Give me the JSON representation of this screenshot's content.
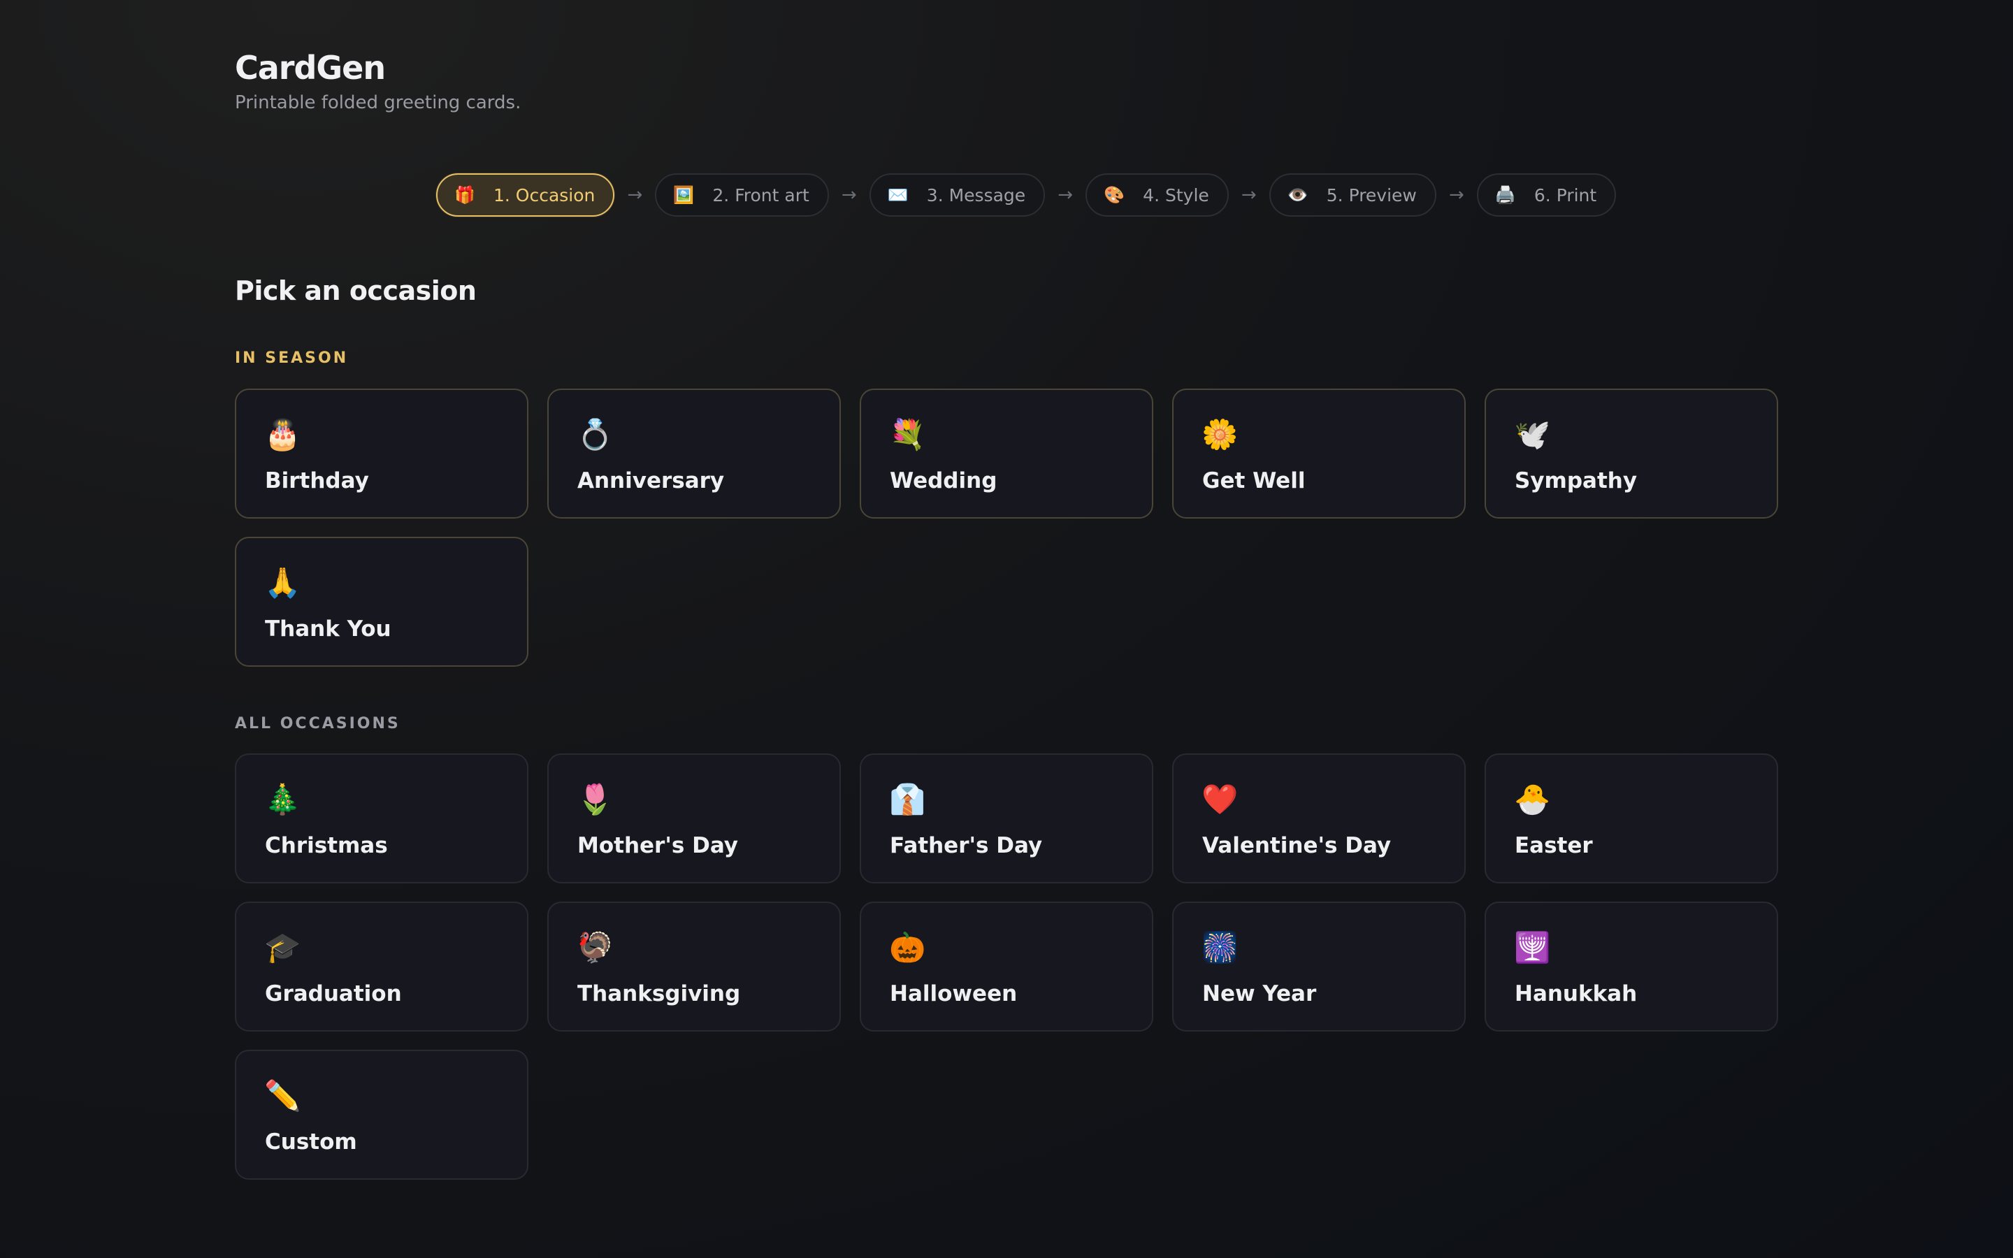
{
  "app": {
    "title": "CardGen",
    "subtitle": "Printable folded greeting cards."
  },
  "stepper": {
    "steps": [
      {
        "icon": "🎁",
        "label": "1. Occasion",
        "active": true
      },
      {
        "icon": "🖼️",
        "label": "2. Front art",
        "active": false
      },
      {
        "icon": "✉️",
        "label": "3. Message",
        "active": false
      },
      {
        "icon": "🎨",
        "label": "4. Style",
        "active": false
      },
      {
        "icon": "👁️",
        "label": "5. Preview",
        "active": false
      },
      {
        "icon": "🖨️",
        "label": "6. Print",
        "active": false
      }
    ],
    "separator": "→"
  },
  "main": {
    "heading": "Pick an occasion",
    "in_season": {
      "label": "IN SEASON",
      "cards": [
        {
          "icon": "🎂",
          "label": "Birthday"
        },
        {
          "icon": "💍",
          "label": "Anniversary"
        },
        {
          "icon": "💐",
          "label": "Wedding"
        },
        {
          "icon": "🌼",
          "label": "Get Well"
        },
        {
          "icon": "🕊️",
          "label": "Sympathy"
        },
        {
          "icon": "🙏",
          "label": "Thank You"
        }
      ]
    },
    "all": {
      "label": "ALL OCCASIONS",
      "cards": [
        {
          "icon": "🎄",
          "label": "Christmas"
        },
        {
          "icon": "🌷",
          "label": "Mother's Day"
        },
        {
          "icon": "👔",
          "label": "Father's Day"
        },
        {
          "icon": "❤️",
          "label": "Valentine's Day"
        },
        {
          "icon": "🐣",
          "label": "Easter"
        },
        {
          "icon": "🎓",
          "label": "Graduation"
        },
        {
          "icon": "🦃",
          "label": "Thanksgiving"
        },
        {
          "icon": "🎃",
          "label": "Halloween"
        },
        {
          "icon": "🎆",
          "label": "New Year"
        },
        {
          "icon": "🕎",
          "label": "Hanukkah"
        },
        {
          "icon": "✏️",
          "label": "Custom"
        }
      ]
    }
  },
  "colors": {
    "accent": "#e7c066",
    "background": "#121418",
    "card": "#17181f"
  }
}
